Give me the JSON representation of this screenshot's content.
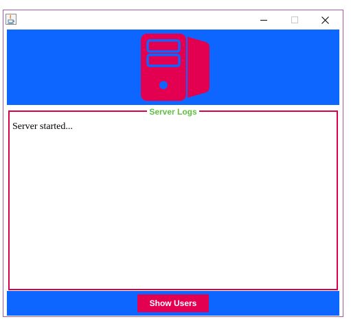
{
  "window": {
    "app_icon": "java-icon",
    "controls": {
      "minimize_icon": "minimize-icon",
      "maximize_icon": "maximize-icon",
      "close_icon": "close-icon"
    },
    "border_color": "#a15ba6"
  },
  "banner": {
    "icon": "server-icon",
    "background": "#0d66ff",
    "icon_color": "#e40050"
  },
  "logs": {
    "title": "Server Logs",
    "title_color": "#5fbf3e",
    "border_color": "#d8004a",
    "content": "Server started..."
  },
  "footer": {
    "background": "#0d66ff",
    "show_users_label": "Show Users",
    "button_color": "#e40050"
  }
}
